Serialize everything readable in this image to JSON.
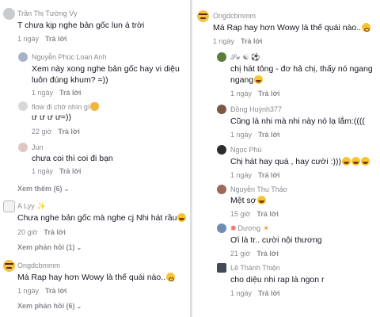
{
  "left": {
    "comments": [
      {
        "user": "Trần Thị Tường Vy",
        "text": "T chưa kịp nghe bản gốc lun á trời",
        "time": "1 ngày",
        "reply": "Trả lời"
      },
      {
        "user": "Nguyễn Phúc Loan Anh",
        "text_line1": "Xem này xong nghe bản gốc hay vi diệu",
        "text_line2": "luôn đúng khum? =))",
        "time": "1 ngày",
        "reply": "Trả lời"
      },
      {
        "user": "flow đi chớ nhìn gì",
        "text": "ư ư ư ư=))",
        "time": "22 giờ",
        "reply": "Trả lời"
      },
      {
        "user": "Jun",
        "text": "chưa coi thì coi đi bạn",
        "time": "1 ngày",
        "reply": "Trả lời"
      }
    ],
    "view_more_1": "Xem thêm (6)",
    "comment_lyy": {
      "user": "A Lyy",
      "text": "Chưa nghe bản gốc mà nghe cj Nhi hát rầu",
      "time": "20 giờ",
      "reply": "Trả lời"
    },
    "view_replies_1": "Xem phản hồi (1)",
    "comment_ongdc": {
      "user": "Ongdcbmmm",
      "text": "Má Rap hay hơn Wowy là thế quái nào..",
      "time": "1 ngày",
      "reply": "Trả lời"
    },
    "view_replies_2": "Xem phản hồi (6)"
  },
  "right": {
    "main": {
      "user": "Ongdcbmmm",
      "text": "Má Rap hay hơn Wowy là thế quái nào..",
      "time": "1 ngày",
      "reply": "Trả lời"
    },
    "replies": [
      {
        "user": "𝓢𝓾",
        "text_line1": "chị hát tông - đơ hả chị, thấy nó ngang",
        "text_line2": "ngang",
        "time": "1 ngày",
        "reply": "Trả lời"
      },
      {
        "user": "Đồng Huỳnh377",
        "text": "Cũng là nhi mà nhi này nó lạ lắm:((((",
        "time": "1 ngày",
        "reply": "Trả lời"
      },
      {
        "user": "Ngọc Phú",
        "text": "Chị hát hay quá , hay cười :)))",
        "time": "1 ngày",
        "reply": "Trả lời"
      },
      {
        "user": "Nguyễn Thu Thảo",
        "text": "Mệt sợ",
        "time": "15 giờ",
        "reply": "Trả lời"
      },
      {
        "user": "Dương",
        "text": "Ơi là tr.. cười nội thương",
        "time": "21 giờ",
        "reply": "Trả lời"
      },
      {
        "user": "Lê Thành Thiện",
        "text": "cho diệu nhi rap là ngon r",
        "time": "1 ngày",
        "reply": "Trả lời"
      }
    ]
  },
  "colors": {
    "muted": "#8a8b91",
    "text": "#161823",
    "emoji": "#f7c531"
  }
}
